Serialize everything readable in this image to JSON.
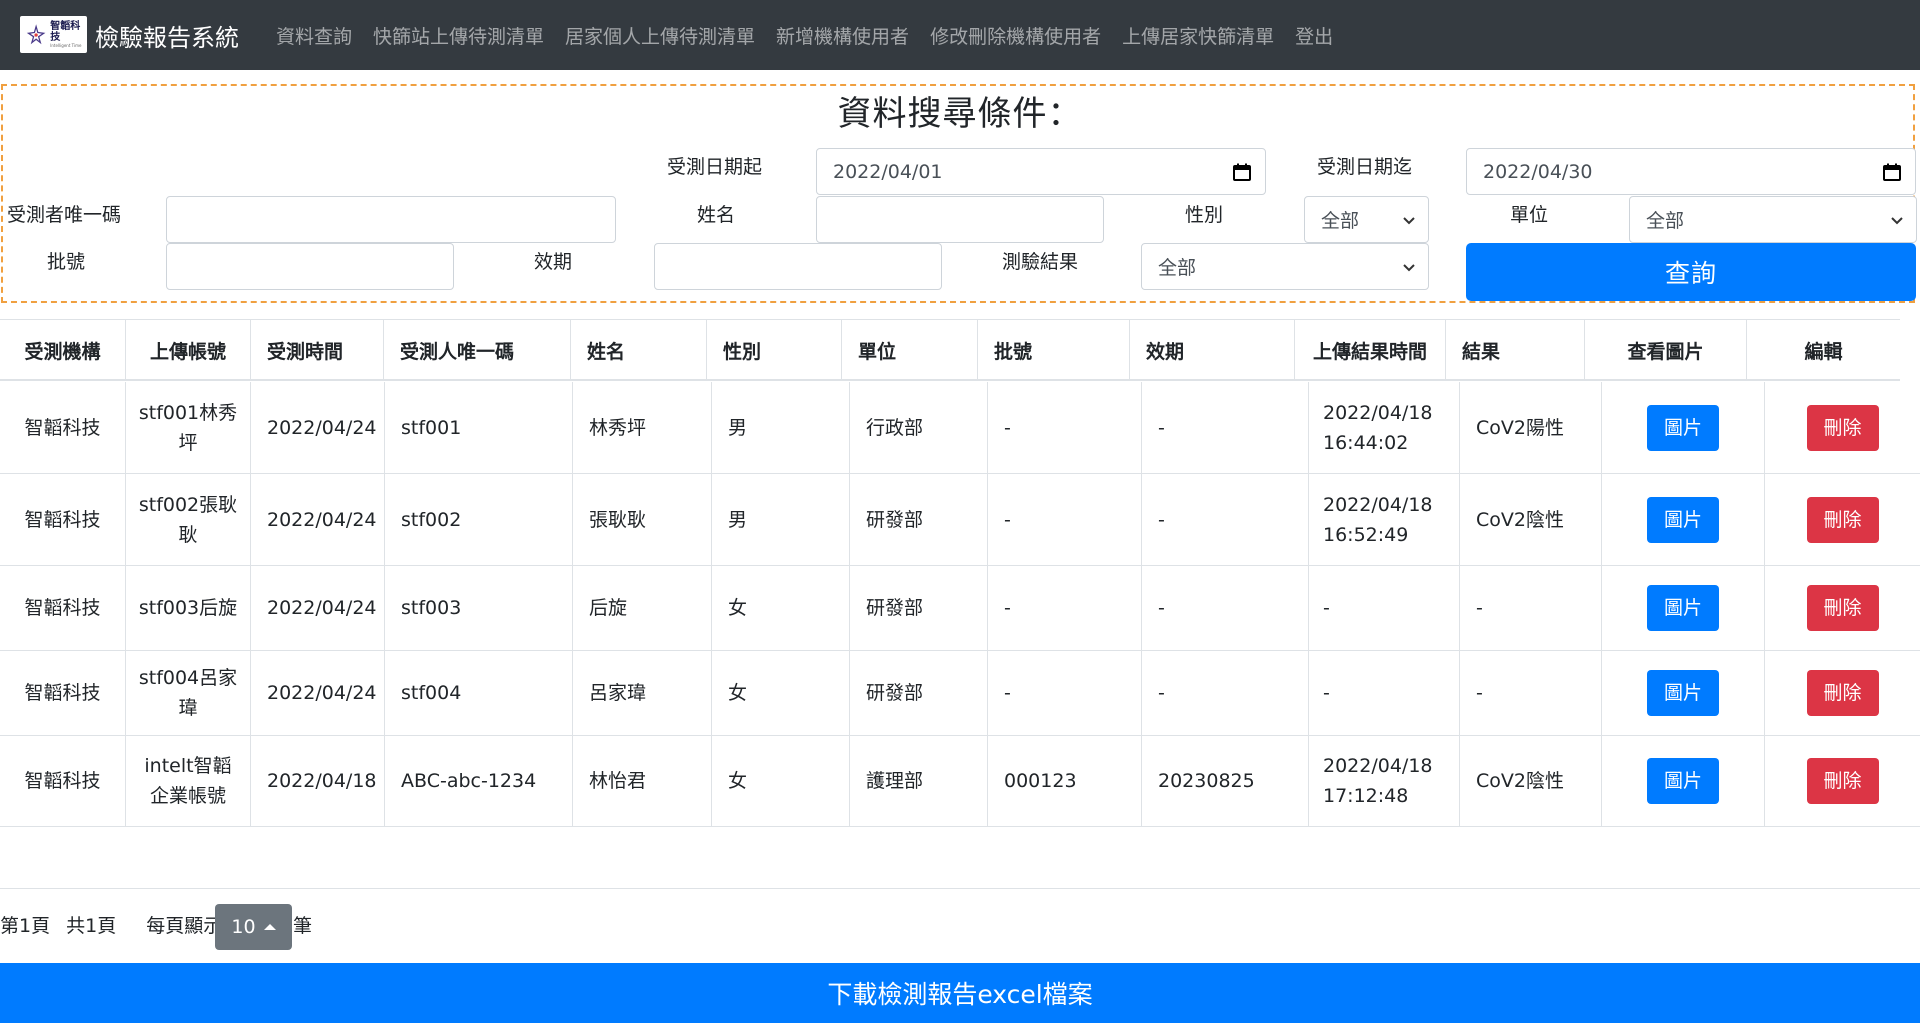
{
  "navbar": {
    "logo_text": "智韜科技",
    "logo_subtext": "Intelligent Time",
    "brand": "檢驗報告系統",
    "links": [
      "資料查詢",
      "快篩站上傳待測清單",
      "居家個人上傳待測清單",
      "新增機構使用者",
      "修改刪除機構使用者",
      "上傳居家快篩清單",
      "登出"
    ]
  },
  "search": {
    "title": "資料搜尋條件：",
    "date_from_label": "受測日期起",
    "date_from_value": "2022/04/01",
    "date_to_label": "受測日期迄",
    "date_to_value": "2022/04/30",
    "uid_label": "受測者唯一碼",
    "uid_value": "",
    "name_label": "姓名",
    "name_value": "",
    "gender_label": "性別",
    "gender_value": "全部",
    "unit_label": "單位",
    "unit_value": "全部",
    "batch_label": "批號",
    "batch_value": "",
    "expiry_label": "效期",
    "expiry_value": "",
    "result_label": "測驗結果",
    "result_value": "全部",
    "query_button": "查詢"
  },
  "table": {
    "headers": [
      "受測機構",
      "上傳帳號",
      "受測時間",
      "受測人唯一碼",
      "姓名",
      "性別",
      "單位",
      "批號",
      "效期",
      "上傳結果時間",
      "結果",
      "查看圖片",
      "編輯"
    ],
    "image_button": "圖片",
    "delete_button": "刪除",
    "rows": [
      {
        "org": "智韜科技",
        "account": "stf001林秀坪",
        "time": "2022/04/24",
        "uid": "stf001",
        "name": "林秀坪",
        "gender": "男",
        "unit": "行政部",
        "batch": "-",
        "expiry": "-",
        "upload_time": "2022/04/18 16:44:02",
        "result": "CoV2陽性"
      },
      {
        "org": "智韜科技",
        "account": "stf002張耿耿",
        "time": "2022/04/24",
        "uid": "stf002",
        "name": "張耿耿",
        "gender": "男",
        "unit": "研發部",
        "batch": "-",
        "expiry": "-",
        "upload_time": "2022/04/18 16:52:49",
        "result": "CoV2陰性"
      },
      {
        "org": "智韜科技",
        "account": "stf003后旋",
        "time": "2022/04/24",
        "uid": "stf003",
        "name": "后旋",
        "gender": "女",
        "unit": "研發部",
        "batch": "-",
        "expiry": "-",
        "upload_time": "-",
        "result": "-"
      },
      {
        "org": "智韜科技",
        "account": "stf004呂家瑋",
        "time": "2022/04/24",
        "uid": "stf004",
        "name": "呂家瑋",
        "gender": "女",
        "unit": "研發部",
        "batch": "-",
        "expiry": "-",
        "upload_time": "-",
        "result": "-"
      },
      {
        "org": "智韜科技",
        "account": "intelt智韜企業帳號",
        "time": "2022/04/18",
        "uid": "ABC-abc-1234",
        "name": "林怡君",
        "gender": "女",
        "unit": "護理部",
        "batch": "000123",
        "expiry": "20230825",
        "upload_time": "2022/04/18 17:12:48",
        "result": "CoV2陰性"
      }
    ]
  },
  "pager": {
    "page_text": "第1頁",
    "total_text": "共1頁",
    "per_page_label": "每頁顯示",
    "per_page_value": "10",
    "unit_text": "筆"
  },
  "download_button": "下載檢測報告excel檔案",
  "colors": {
    "navbar_bg": "#343a40",
    "primary": "#007bff",
    "danger": "#dc3545",
    "secondary": "#6c757d",
    "panel_border": "#f0a040"
  }
}
